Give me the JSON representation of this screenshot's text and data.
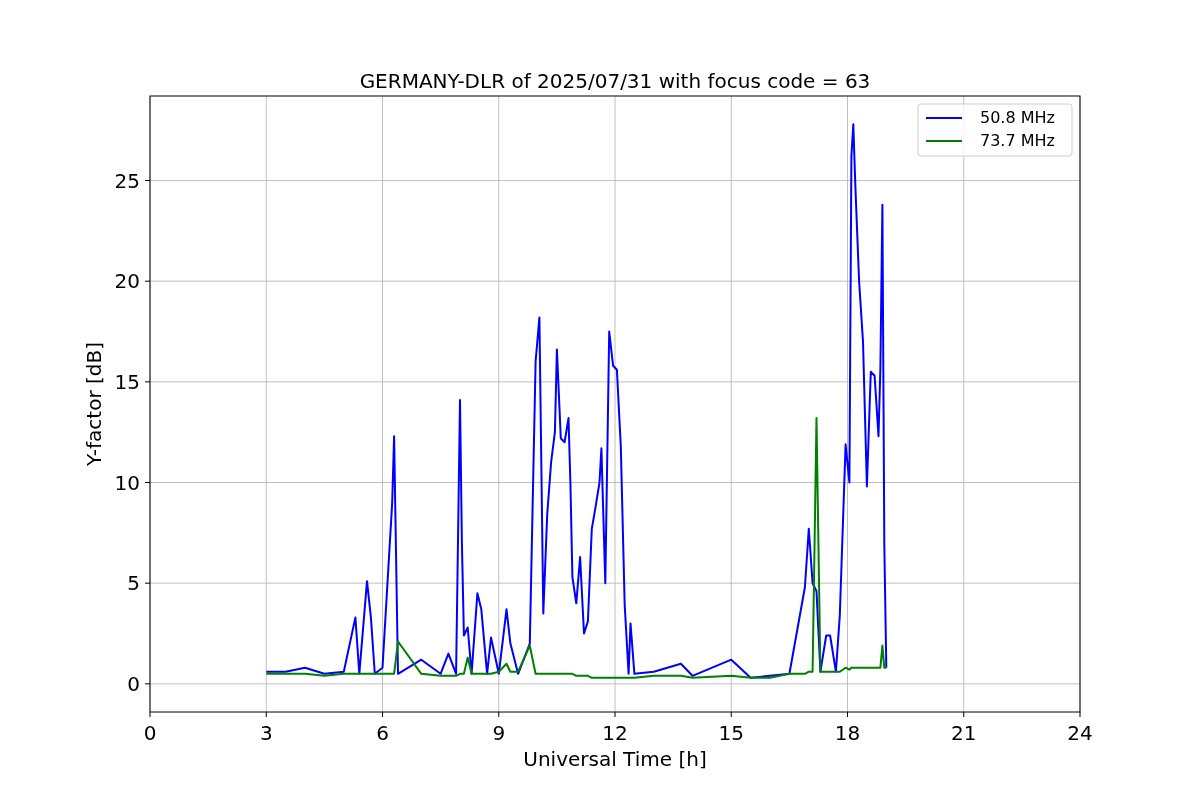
{
  "chart_data": {
    "type": "line",
    "title": "GERMANY-DLR of 2025/07/31 with focus code = 63",
    "xlabel": "Universal Time [h]",
    "ylabel": "Y-factor [dB]",
    "xlim": [
      0,
      24
    ],
    "ylim": [
      -1.4,
      29.2
    ],
    "xticks": [
      0,
      3,
      6,
      9,
      12,
      15,
      18,
      21,
      24
    ],
    "yticks": [
      0,
      5,
      10,
      15,
      20,
      25
    ],
    "grid": true,
    "legend": true,
    "x": [
      3.0,
      3.5,
      4.0,
      4.5,
      5.0,
      5.3,
      5.4,
      5.6,
      5.7,
      5.8,
      6.0,
      6.25,
      6.3,
      6.4,
      7.0,
      7.5,
      7.7,
      7.9,
      8.0,
      8.05,
      8.1,
      8.2,
      8.3,
      8.45,
      8.55,
      8.7,
      8.8,
      9.0,
      9.2,
      9.3,
      9.5,
      9.8,
      9.95,
      10.05,
      10.15,
      10.25,
      10.35,
      10.45,
      10.5,
      10.6,
      10.7,
      10.8,
      10.85,
      10.9,
      11.0,
      11.1,
      11.2,
      11.3,
      11.4,
      11.5,
      11.6,
      11.65,
      11.75,
      11.85,
      11.95,
      12.05,
      12.15,
      12.25,
      12.35,
      12.4,
      12.5,
      13.0,
      13.7,
      14.0,
      15.0,
      15.5,
      16.0,
      16.5,
      16.9,
      17.0,
      17.1,
      17.2,
      17.3,
      17.45,
      17.55,
      17.7,
      17.8,
      17.95,
      18.05,
      18.1,
      18.15,
      18.2,
      18.3,
      18.4,
      18.5,
      18.6,
      18.7,
      18.8,
      18.85,
      18.9,
      18.95,
      19.0
    ],
    "series": [
      {
        "name": "50.8 MHz",
        "color": "#0000ff",
        "values": [
          0.6,
          0.6,
          0.8,
          0.5,
          0.6,
          3.3,
          0.5,
          5.1,
          3.3,
          0.5,
          0.8,
          9.0,
          12.3,
          0.5,
          1.2,
          0.5,
          1.5,
          0.5,
          14.1,
          7.0,
          2.4,
          2.8,
          0.5,
          4.5,
          3.7,
          0.5,
          2.3,
          0.5,
          3.7,
          2.0,
          0.5,
          2.0,
          16.0,
          18.2,
          3.5,
          8.4,
          11.0,
          12.5,
          16.6,
          12.2,
          12.0,
          13.2,
          10.0,
          5.3,
          4.0,
          6.3,
          2.5,
          3.1,
          7.7,
          8.8,
          10.0,
          11.7,
          5.0,
          17.5,
          15.8,
          15.6,
          11.8,
          3.9,
          0.5,
          3.0,
          0.5,
          0.6,
          1.0,
          0.4,
          1.2,
          0.3,
          0.4,
          0.5,
          4.8,
          7.7,
          5.0,
          4.6,
          0.6,
          2.4,
          2.4,
          0.6,
          3.4,
          11.9,
          10.0,
          26.2,
          27.8,
          24.8,
          20.0,
          17.0,
          9.8,
          15.5,
          15.3,
          12.3,
          15.7,
          23.8,
          7.0,
          0.8
        ]
      },
      {
        "name": "73.7 MHz",
        "color": "#008000",
        "values": [
          0.5,
          0.5,
          0.5,
          0.4,
          0.5,
          0.5,
          0.5,
          0.5,
          0.5,
          0.5,
          0.5,
          0.5,
          0.5,
          2.1,
          0.5,
          0.4,
          0.4,
          0.4,
          0.5,
          0.5,
          0.5,
          1.3,
          0.5,
          0.5,
          0.5,
          0.5,
          0.5,
          0.6,
          1.0,
          0.6,
          0.6,
          1.9,
          0.5,
          0.5,
          0.5,
          0.5,
          0.5,
          0.5,
          0.5,
          0.5,
          0.5,
          0.5,
          0.5,
          0.5,
          0.4,
          0.4,
          0.4,
          0.4,
          0.3,
          0.3,
          0.3,
          0.3,
          0.3,
          0.3,
          0.3,
          0.3,
          0.3,
          0.3,
          0.3,
          0.3,
          0.3,
          0.4,
          0.4,
          0.3,
          0.4,
          0.3,
          0.3,
          0.5,
          0.5,
          0.6,
          0.6,
          13.2,
          0.6,
          0.6,
          0.6,
          0.6,
          0.6,
          0.8,
          0.7,
          0.8,
          0.8,
          0.8,
          0.8,
          0.8,
          0.8,
          0.8,
          0.8,
          0.8,
          0.8,
          1.9,
          0.8,
          0.8
        ]
      }
    ]
  }
}
